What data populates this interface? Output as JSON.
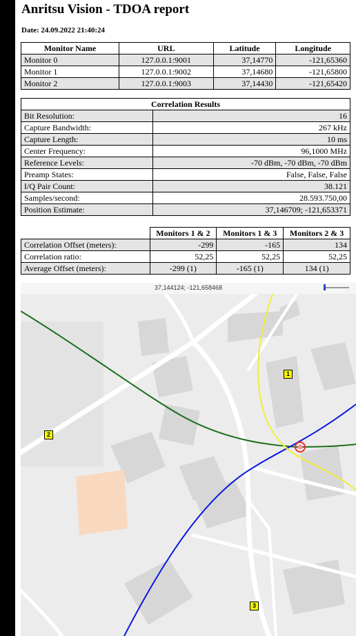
{
  "report": {
    "title": "Anritsu Vision - TDOA report",
    "date": "Date: 24.09.2022 21:40:24"
  },
  "monitors_table": {
    "headers": [
      "Monitor Name",
      "URL",
      "Latitude",
      "Longitude"
    ],
    "rows": [
      {
        "name": "Monitor 0",
        "url": "127.0.0.1:9001",
        "lat": "37,14770",
        "lon": "-121,65360"
      },
      {
        "name": "Monitor 1",
        "url": "127.0.0.1:9002",
        "lat": "37,14680",
        "lon": "-121,65800"
      },
      {
        "name": "Monitor 2",
        "url": "127.0.0.1:9003",
        "lat": "37,14430",
        "lon": "-121,65420"
      }
    ]
  },
  "correlation": {
    "title": "Correlation Results",
    "rows": [
      {
        "label": "Bit Resolution:",
        "value": "16"
      },
      {
        "label": "Capture Bandwidth:",
        "value": "267 kHz"
      },
      {
        "label": "Capture Length:",
        "value": "10 ms"
      },
      {
        "label": "Center Frequency:",
        "value": "96,1000 MHz"
      },
      {
        "label": "Reference Levels:",
        "value": "-70 dBm, -70 dBm, -70 dBm"
      },
      {
        "label": "Preamp States:",
        "value": "False, False, False"
      },
      {
        "label": "I/Q Pair Count:",
        "value": "38.121"
      },
      {
        "label": "Samples/second:",
        "value": "28.593.750,00"
      },
      {
        "label": "Position Estimate:",
        "value": "37,146709; -121,653371"
      }
    ]
  },
  "offsets_table": {
    "headers": [
      "Monitors 1 & 2",
      "Monitors 1 & 3",
      "Monitors 2 & 3"
    ],
    "rows": [
      {
        "label": "Correlation Offset (meters):",
        "values": [
          "-299",
          "-165",
          "134"
        ]
      },
      {
        "label": "Correlation ratio:",
        "values": [
          "52,25",
          "52,25",
          "52,25"
        ]
      },
      {
        "label": "Average Offset (meters):",
        "values": [
          "-299 (1)",
          "-165 (1)",
          "134 (1)"
        ]
      }
    ]
  },
  "map": {
    "coordinates": "37,144124; -121,658468",
    "markers": [
      "1",
      "2",
      "3"
    ],
    "colors": {
      "curve_1_2": "#1a6e1a",
      "curve_1_3": "#0a18e0",
      "curve_2_3": "#f0ee3a",
      "estimate": "#e03030"
    }
  }
}
